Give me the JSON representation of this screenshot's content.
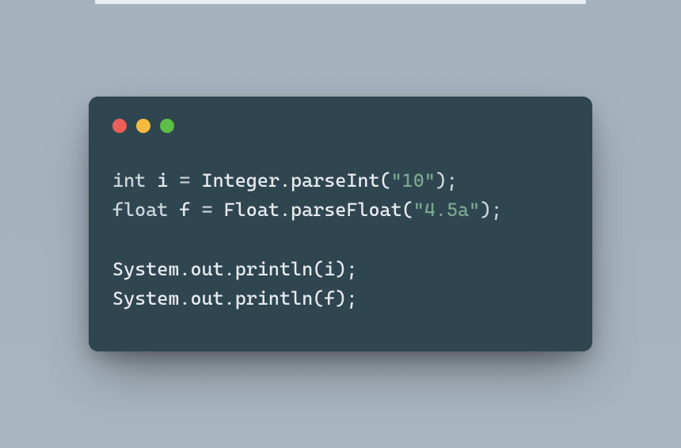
{
  "window": {
    "dots": {
      "red": "#ec5e57",
      "yellow": "#f4ba40",
      "green": "#5ebe46"
    },
    "background": "#2f4550"
  },
  "code": {
    "line1": {
      "kw": "int",
      "var": "i",
      "eq": " = ",
      "call": "Integer.parseInt(",
      "str": "\"10\"",
      "end": ");"
    },
    "line2": {
      "kw": "float",
      "var": "f",
      "eq": " = ",
      "call": "Float.parseFloat(",
      "str": "\"4.5a\"",
      "end": ");"
    },
    "line4": "System.out.println(i);",
    "line5": "System.out.println(f);"
  }
}
